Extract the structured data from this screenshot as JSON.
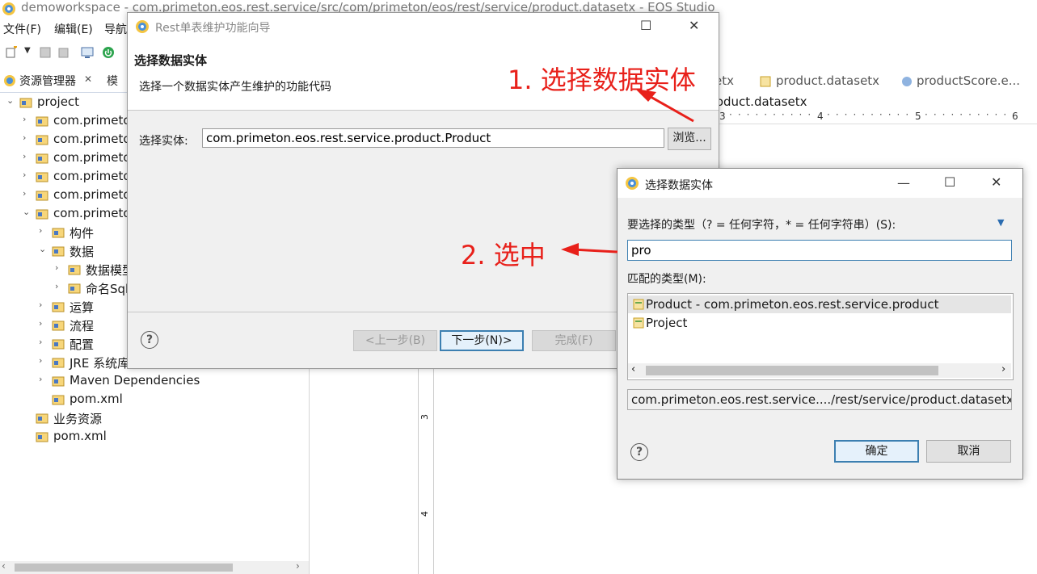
{
  "window": {
    "title": "demoworkspace - com.primeton.eos.rest.service/src/com/primeton/eos/rest/service/product.datasetx - EOS Studio"
  },
  "menu": [
    "文件(F)",
    "编辑(E)",
    "导航"
  ],
  "explorer": {
    "tab_label": "资源管理器",
    "tab_close": "✕",
    "tree": [
      {
        "label": "project",
        "level": 0,
        "expanded": true
      },
      {
        "label": "com.primeto",
        "level": 1,
        "expanded": false
      },
      {
        "label": "com.primeto",
        "level": 1,
        "expanded": false
      },
      {
        "label": "com.primeto",
        "level": 1,
        "expanded": false
      },
      {
        "label": "com.primeto",
        "level": 1,
        "expanded": false
      },
      {
        "label": "com.primeto",
        "level": 1,
        "expanded": false
      },
      {
        "label": "com.primeto",
        "level": 1,
        "expanded": true
      },
      {
        "label": "构件",
        "level": 2,
        "expanded": false
      },
      {
        "label": "数据",
        "level": 2,
        "expanded": true
      },
      {
        "label": "数据模型",
        "level": 3,
        "expanded": false
      },
      {
        "label": "命名Sql",
        "level": 3,
        "expanded": false
      },
      {
        "label": "运算",
        "level": 2,
        "expanded": false
      },
      {
        "label": "流程",
        "level": 2,
        "expanded": false
      },
      {
        "label": "配置",
        "level": 2,
        "expanded": false
      },
      {
        "label": "JRE 系统库",
        "level": 2,
        "expanded": false
      },
      {
        "label": "Maven Dependencies",
        "level": 2,
        "expanded": false
      },
      {
        "label": "pom.xml",
        "level": 2,
        "expanded": null
      },
      {
        "label": "业务资源",
        "level": 1,
        "expanded": null
      },
      {
        "label": "pom.xml",
        "level": 1,
        "expanded": null
      }
    ]
  },
  "editor": {
    "tabs": [
      "etx",
      "product.datasetx",
      "productScore.e..."
    ],
    "breadcrumb": "roduct.datasetx",
    "ruler": [
      "3",
      "4",
      "5",
      "6"
    ],
    "vruler": [
      "3",
      "4"
    ]
  },
  "wizard": {
    "title": "Rest单表维护功能向导",
    "header_title": "选择数据实体",
    "header_desc": "选择一个数据实体产生维护的功能代码",
    "entity_label": "选择实体:",
    "entity_value": "com.primeton.eos.rest.service.product.Product",
    "browse_label": "浏览...",
    "back_label": "<上一步(B)",
    "next_label": "下一步(N)>",
    "finish_label": "完成(F)",
    "help": "?"
  },
  "select_dialog": {
    "title": "选择数据实体",
    "prompt": "要选择的类型（? = 任何字符，* = 任何字符串）(S):",
    "filter_value": "pro",
    "match_label": "匹配的类型(M):",
    "items": [
      {
        "label": "Product - com.primeton.eos.rest.service.product",
        "selected": true
      },
      {
        "label": "Project",
        "selected": false
      }
    ],
    "path": "com.primeton.eos.rest.service..../rest/service/product.datasetx",
    "ok_label": "确定",
    "cancel_label": "取消",
    "help": "?"
  },
  "annotations": {
    "step1": "1. 选择数据实体",
    "step2": "2. 选中"
  },
  "colors": {
    "annotation": "#e8201a",
    "focus_border": "#3c7fb1",
    "selection": "#e5e5e5"
  }
}
